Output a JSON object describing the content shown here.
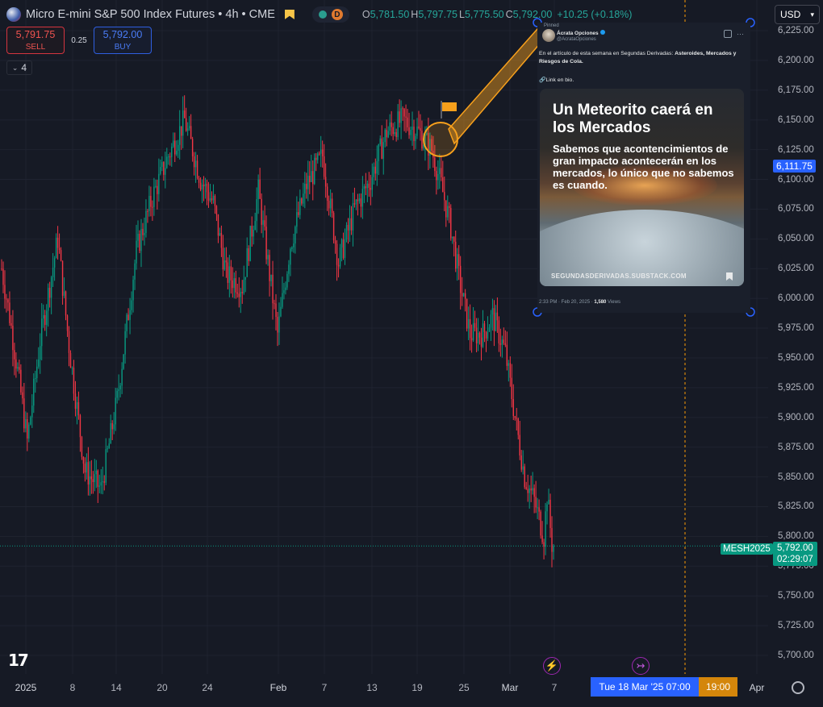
{
  "header": {
    "symbol_title": "Micro E-mini S&P 500 Index Futures • 4h • CME",
    "interval_badge": "D",
    "ohlc": {
      "open_label": "O",
      "open": "5,781.50",
      "high_label": "H",
      "high": "5,797.75",
      "low_label": "L",
      "low": "5,775.50",
      "close_label": "C",
      "close": "5,792.00",
      "change": "+10.25 (+0.18%)"
    }
  },
  "trade": {
    "sell_price": "5,791.75",
    "sell_label": "SELL",
    "spread": "0.25",
    "buy_price": "5,792.00",
    "buy_label": "BUY",
    "lots": "4"
  },
  "currency": "USD",
  "price_axis": {
    "labels": [
      "6,225.00",
      "6,200.00",
      "6,175.00",
      "6,150.00",
      "6,125.00",
      "6,100.00",
      "6,075.00",
      "6,050.00",
      "6,025.00",
      "6,000.00",
      "5,975.00",
      "5,950.00",
      "5,925.00",
      "5,900.00",
      "5,875.00",
      "5,850.00",
      "5,825.00",
      "5,800.00",
      "5,775.00",
      "5,750.00",
      "5,725.00",
      "5,700.00"
    ],
    "crosshair_price": "6,111.75",
    "last_price": "5,792.00",
    "countdown": "02:29:07",
    "symbol_tag": "MESH2025"
  },
  "time_axis": {
    "labels": [
      "2025",
      "8",
      "14",
      "20",
      "24",
      "Feb",
      "7",
      "13",
      "19",
      "25",
      "Mar",
      "7",
      "Apr"
    ],
    "crosshair_time": "Tue 18 Mar '25   07:00",
    "crosshair_time_2": "19:00"
  },
  "tweet": {
    "pinned": "Pinned",
    "name": "Ácrata Opciones",
    "handle": "@AcrataOpciones",
    "text_prefix": "En el artículo de esta semana en Segundas Derivadas: ",
    "text_bold": "Asteroides, Mercados y Riesgos de Cola.",
    "link_line": "🔗Link en bio.",
    "card_title": "Un Meteorito caerá en los Mercados",
    "card_subtitle": "Sabemos que acontencimientos de gran impacto acontecerán en los mercados, lo único que no sabemos es cuando.",
    "card_domain": "SEGUNDASDERIVADAS.SUBSTACK.COM",
    "meta_time": "2:33 PM · Feb 20, 2025 · ",
    "meta_views": "1,580",
    "meta_views_label": " Views"
  },
  "colors": {
    "up": "#089981",
    "down": "#f23645",
    "background": "#161a25",
    "accent": "#2962ff",
    "annotation": "#f7a01c"
  },
  "chart_data": {
    "type": "candlestick",
    "symbol": "MESH2025",
    "interval": "4h",
    "ylim": [
      5690,
      6235
    ],
    "x_labels": [
      "2025",
      "8",
      "14",
      "20",
      "24",
      "Feb",
      "7",
      "13",
      "19",
      "25",
      "Mar",
      "7",
      "Apr"
    ],
    "anchors": [
      [
        0,
        6025
      ],
      [
        5,
        5985
      ],
      [
        12,
        5920
      ],
      [
        16,
        5880
      ],
      [
        24,
        5965
      ],
      [
        35,
        6050
      ],
      [
        42,
        5960
      ],
      [
        52,
        5855
      ],
      [
        62,
        5840
      ],
      [
        72,
        5915
      ],
      [
        84,
        6040
      ],
      [
        94,
        6085
      ],
      [
        104,
        6120
      ],
      [
        114,
        6150
      ],
      [
        124,
        6100
      ],
      [
        132,
        6080
      ],
      [
        140,
        6020
      ],
      [
        150,
        6010
      ],
      [
        160,
        6090
      ],
      [
        172,
        5970
      ],
      [
        180,
        6045
      ],
      [
        190,
        6095
      ],
      [
        200,
        6120
      ],
      [
        210,
        6030
      ],
      [
        220,
        6075
      ],
      [
        230,
        6100
      ],
      [
        240,
        6140
      ],
      [
        250,
        6150
      ],
      [
        260,
        6140
      ],
      [
        268,
        6125
      ],
      [
        274,
        6095
      ],
      [
        280,
        6060
      ],
      [
        286,
        6010
      ],
      [
        292,
        5970
      ],
      [
        300,
        5970
      ],
      [
        306,
        5985
      ],
      [
        314,
        5955
      ],
      [
        320,
        5900
      ],
      [
        326,
        5850
      ],
      [
        332,
        5830
      ],
      [
        338,
        5800
      ],
      [
        340,
        5835
      ],
      [
        344,
        5780
      ]
    ],
    "last": 5792.0
  }
}
